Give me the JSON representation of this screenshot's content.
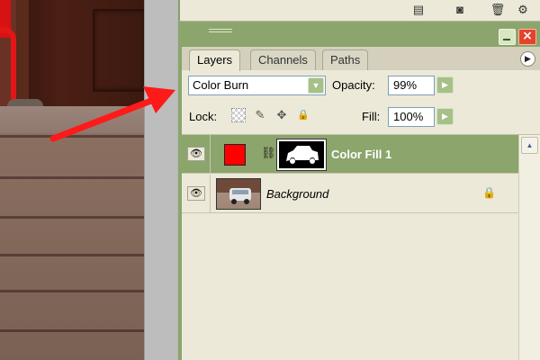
{
  "panel": {
    "tabs": [
      {
        "label": "Layers"
      },
      {
        "label": "Channels"
      },
      {
        "label": "Paths"
      }
    ],
    "blend_mode": "Color Burn",
    "opacity_label": "Opacity:",
    "opacity_value": "99%",
    "lock_label": "Lock:",
    "fill_label": "Fill:",
    "fill_value": "100%"
  },
  "layers": [
    {
      "name": "Color Fill 1",
      "selected": true,
      "fill_color": "#ff0000"
    },
    {
      "name": "Background",
      "selected": false,
      "locked": true
    }
  ],
  "colors": {
    "panel_accent": "#8ba56c",
    "panel_bg": "#ece9d8",
    "annotation_arrow": "#ff1a1a"
  }
}
